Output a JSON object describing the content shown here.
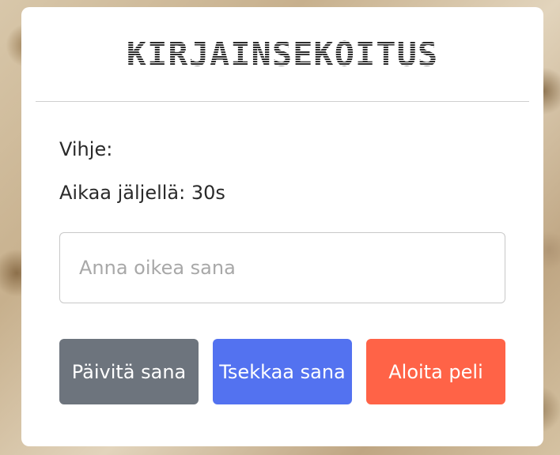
{
  "header": {
    "title": "KIRJAINSEKOITUS"
  },
  "game": {
    "hint_label": "Vihje:",
    "time_label": "Aikaa jäljellä: 30s"
  },
  "input": {
    "value": "",
    "placeholder": "Anna oikea sana"
  },
  "buttons": {
    "refresh_label": "Päivitä sana",
    "check_label": "Tsekkaa sana",
    "start_label": "Aloita peli"
  },
  "colors": {
    "refresh_button": "#6d747d",
    "check_button": "#5372f0",
    "start_button": "#ff6347",
    "card_background": "#ffffff"
  }
}
